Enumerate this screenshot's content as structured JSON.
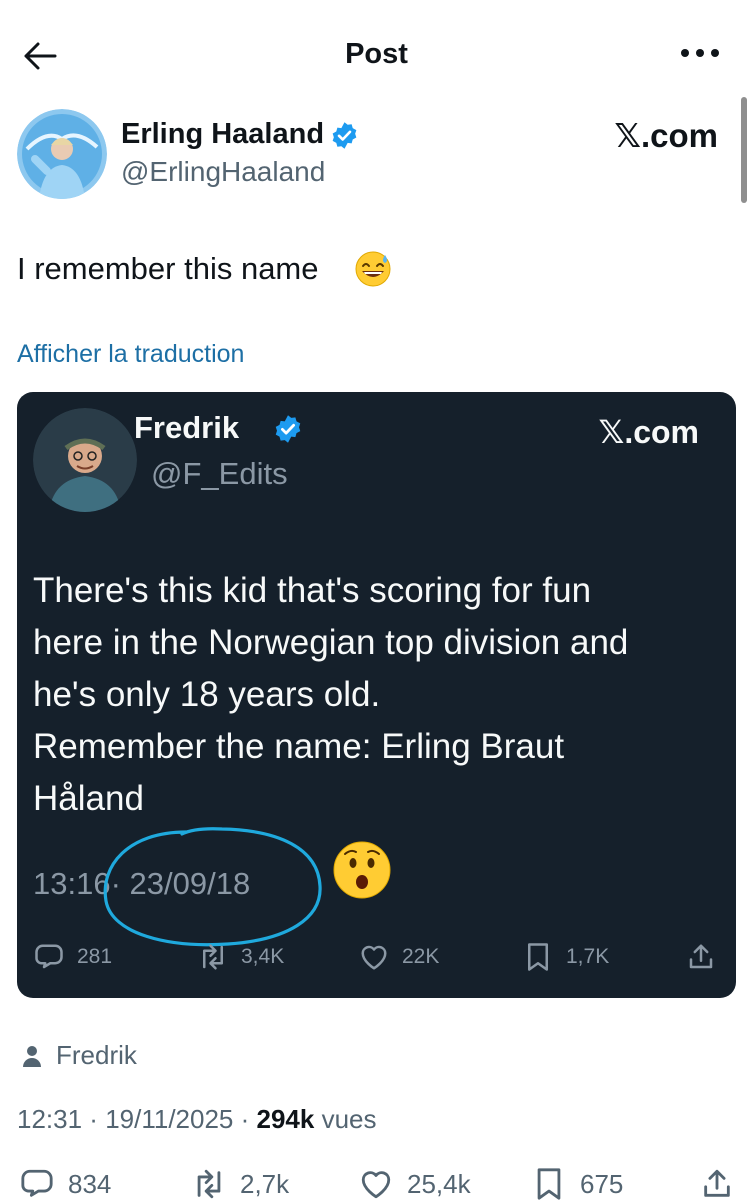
{
  "header": {
    "title": "Post"
  },
  "post": {
    "author_name": "Erling Haaland",
    "author_handle": "@ErlingHaaland",
    "source": "𝕏.com",
    "text": "I remember this name",
    "translate_label": "Afficher la traduction",
    "viewer_label": "Fredrik",
    "time": "12:31",
    "date": "19/11/2025",
    "views_count": "294k",
    "views_label": "vues",
    "stats": {
      "replies": "834",
      "reposts": "2,7k",
      "likes": "25,4k",
      "bookmarks": "675"
    }
  },
  "quoted": {
    "author_name": "Fredrik",
    "author_handle": "@F_Edits",
    "source": "𝕏.com",
    "text": "There's this kid that's scoring for fun\nhere in the Norwegian top division and\nhe's only 18 years old.\nRemember the name: Erling Braut\nHåland",
    "time": "13:16",
    "date": "23/09/18",
    "stats": {
      "replies": "281",
      "reposts": "3,4K",
      "likes": "22K",
      "bookmarks": "1,7K"
    }
  },
  "colors": {
    "accent": "#1d9bf0",
    "card_bg": "#15202b",
    "link": "#1d6fa5",
    "annotation": "#1fa9dd"
  },
  "icons": [
    "back-arrow-icon",
    "more-icon",
    "verified-badge-icon",
    "sweat-smile-emoji",
    "surprised-emoji",
    "reply-icon",
    "repost-icon",
    "like-icon",
    "bookmark-icon",
    "share-icon",
    "person-icon"
  ]
}
